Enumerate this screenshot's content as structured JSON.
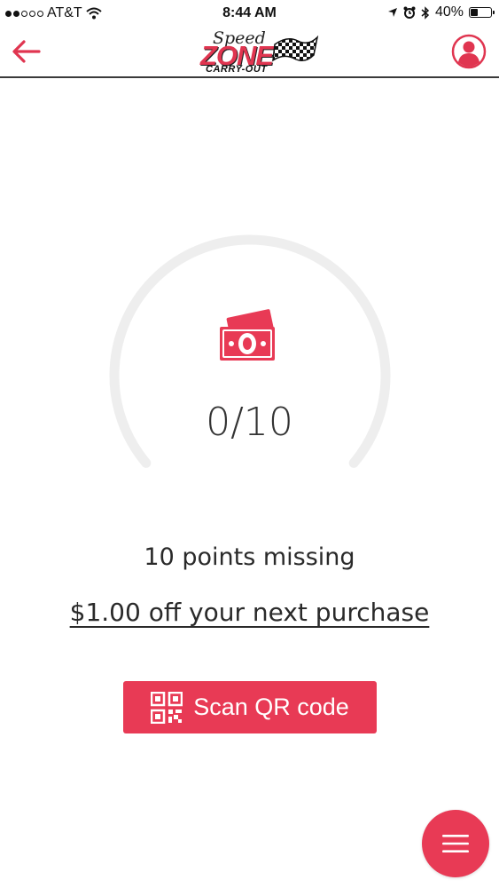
{
  "status_bar": {
    "carrier": "AT&T",
    "time": "8:44 AM",
    "battery": "40%",
    "battery_level": 0.4,
    "signal_bars": 2
  },
  "header": {
    "logo_speed": "Speed",
    "logo_zone": "ZONE",
    "logo_carry_out": "CARRY-OUT"
  },
  "rewards": {
    "points_current": 0,
    "points_target": 10,
    "counter_text": "0/10",
    "missing_text": "10 points missing",
    "reward_text": "$1.00 off your next purchase"
  },
  "actions": {
    "scan_label": "Scan QR code"
  },
  "colors": {
    "accent": "#e83a55",
    "ring_track": "#eeeeee",
    "text": "#2a2a2a"
  },
  "icons": {
    "back": "arrow-left-icon",
    "profile": "user-icon",
    "reward": "cash-icon",
    "scan": "qr-code-icon",
    "menu": "hamburger-menu-icon"
  }
}
